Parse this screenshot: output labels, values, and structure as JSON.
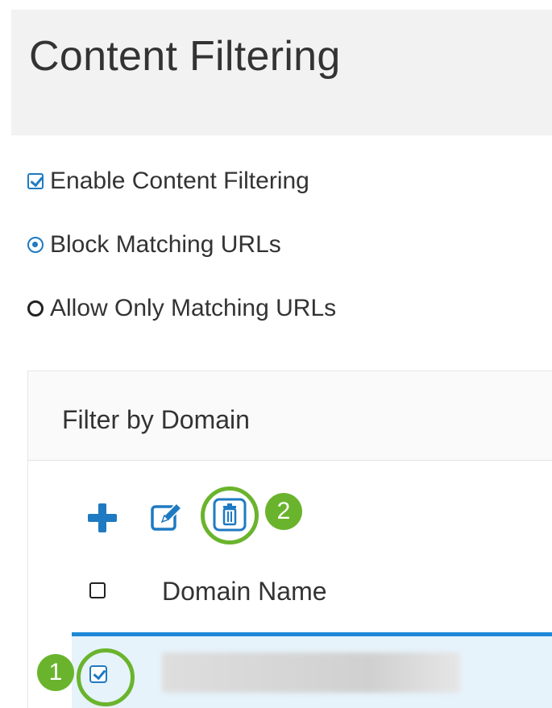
{
  "page": {
    "title": "Content Filtering"
  },
  "options": {
    "enable_label": "Enable Content Filtering",
    "enable_checked": true,
    "block_label": "Block Matching URLs",
    "block_selected": true,
    "allow_label": "Allow Only Matching URLs",
    "allow_selected": false
  },
  "filter_panel": {
    "title": "Filter by Domain",
    "toolbar": {
      "add_icon": "plus-icon",
      "edit_icon": "edit-icon",
      "delete_icon": "trash-icon"
    },
    "table": {
      "columns": [
        "Domain Name"
      ],
      "rows": [
        {
          "selected": true,
          "domain": ""
        }
      ]
    }
  },
  "annotations": {
    "step1": "1",
    "step2": "2",
    "highlight_color": "#6ab42d"
  },
  "colors": {
    "accent": "#1e7ac2",
    "selected_row_bg": "#e6f3fb",
    "selected_row_border": "#1e88d6"
  }
}
